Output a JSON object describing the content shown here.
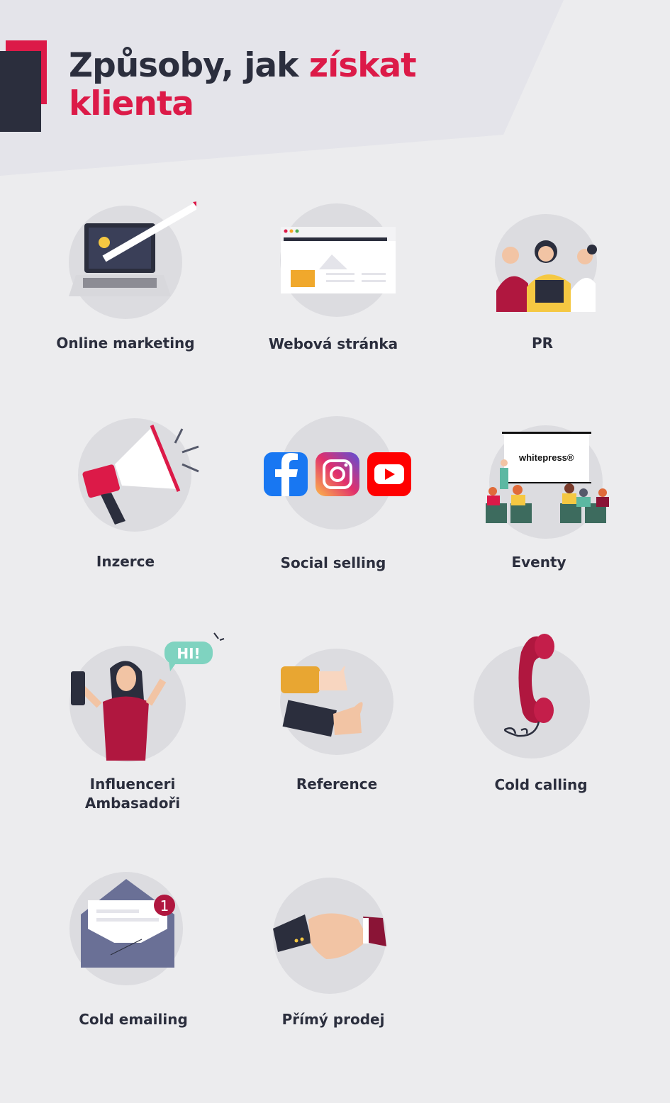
{
  "header": {
    "title_dark": "Způsoby, jak",
    "title_accent_1": "získat",
    "title_accent_2": "klienta"
  },
  "colors": {
    "accent": "#dc1a48",
    "dark": "#2b2e3d",
    "background": "#ececee",
    "blob": "#dcdce0"
  },
  "items": [
    {
      "label": "Online marketing",
      "icon": "laptop-rocket-icon"
    },
    {
      "label": "Webová stránka",
      "icon": "browser-window-icon"
    },
    {
      "label": "PR",
      "icon": "people-group-icon"
    },
    {
      "label": "Inzerce",
      "icon": "megaphone-icon"
    },
    {
      "label": "Social selling",
      "icon": "social-media-icons",
      "bubble": ""
    },
    {
      "label": "Eventy",
      "icon": "presentation-audience-icon",
      "screen_logo": "whitepress®"
    },
    {
      "label": "Influenceri",
      "label2": "Ambasadoři",
      "icon": "influencer-selfie-icon",
      "bubble": "HI!"
    },
    {
      "label": "Reference",
      "icon": "thumbs-up-icon"
    },
    {
      "label": "Cold calling",
      "icon": "telephone-handset-icon"
    },
    {
      "label": "Cold emailing",
      "icon": "envelope-icon",
      "badge": "1"
    },
    {
      "label": "Přímý prodej",
      "icon": "handshake-icon"
    }
  ]
}
